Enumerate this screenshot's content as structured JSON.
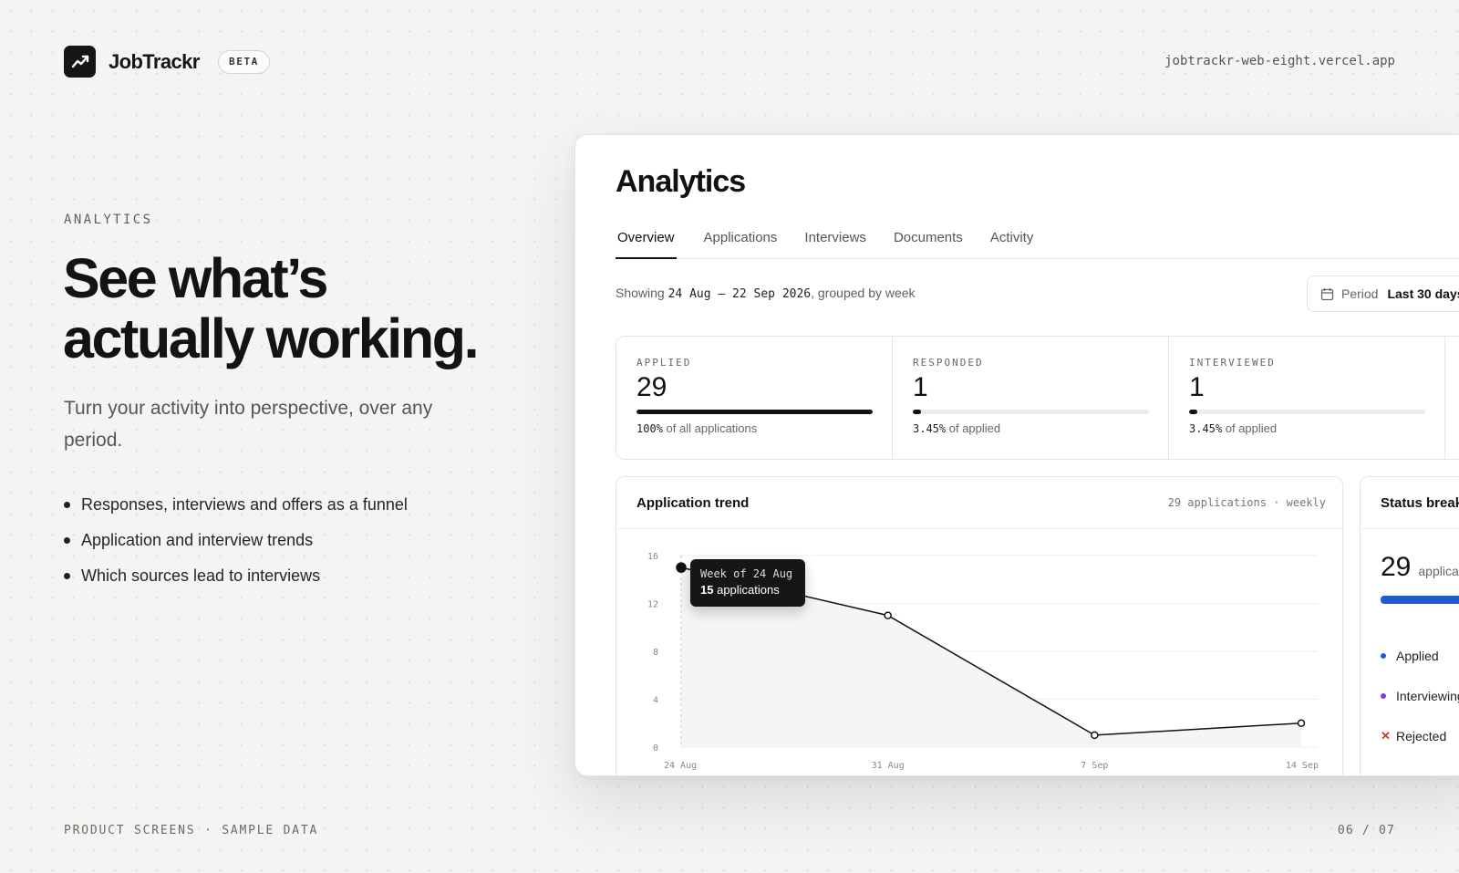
{
  "brand": {
    "name": "JobTrackr",
    "badge": "BETA",
    "url": "jobtrackr-web-eight.vercel.app"
  },
  "hero": {
    "eyebrow": "ANALYTICS",
    "title_line1": "See what’s",
    "title_line2": "actually working.",
    "subtitle": "Turn your activity into perspective, over any period.",
    "bullets": [
      "Responses, interviews and offers as a funnel",
      "Application and interview trends",
      "Which sources lead to interviews"
    ]
  },
  "footer": {
    "left": "PRODUCT SCREENS · SAMPLE DATA",
    "right": "06 / 07"
  },
  "app": {
    "title": "Analytics",
    "tabs": [
      "Overview",
      "Applications",
      "Interviews",
      "Documents",
      "Activity"
    ],
    "active_tab": "Overview",
    "showing_prefix": "Showing",
    "showing_range": "24 Aug – 22 Sep 2026",
    "showing_suffix": ", grouped by week",
    "period_label": "Period",
    "period_value": "Last 30 days",
    "stats": [
      {
        "label": "APPLIED",
        "value": "29",
        "pct": "100%",
        "note": "of all applications",
        "fill": 1.0
      },
      {
        "label": "RESPONDED",
        "value": "1",
        "pct": "3.45%",
        "note": "of applied",
        "fill": 0.0345
      },
      {
        "label": "INTERVIEWED",
        "value": "1",
        "pct": "3.45%",
        "note": "of applied",
        "fill": 0.0345
      }
    ],
    "trend": {
      "title": "Application trend",
      "meta": "29 applications · weekly",
      "tooltip_title": "Week of 24 Aug",
      "tooltip_count": "15",
      "tooltip_unit": "applications"
    },
    "status": {
      "title": "Status breakdown",
      "count": "29",
      "count_label": "applications",
      "legend": [
        {
          "label": "Applied",
          "color": "#1f5bd6",
          "marker": "dot"
        },
        {
          "label": "Interviewing",
          "color": "#7b3fd6",
          "marker": "dot"
        },
        {
          "label": "Rejected",
          "color": "#d23a2f",
          "marker": "x"
        }
      ]
    }
  },
  "chart_data": {
    "type": "line",
    "title": "Application trend",
    "x": [
      "24 Aug",
      "31 Aug",
      "7 Sep",
      "14 Sep"
    ],
    "series": [
      {
        "values": [
          15,
          11,
          1,
          2
        ]
      }
    ],
    "ylim": [
      0,
      16
    ],
    "yticks": [
      0,
      4,
      8,
      12,
      16
    ],
    "grid": true,
    "color": "#111111"
  }
}
